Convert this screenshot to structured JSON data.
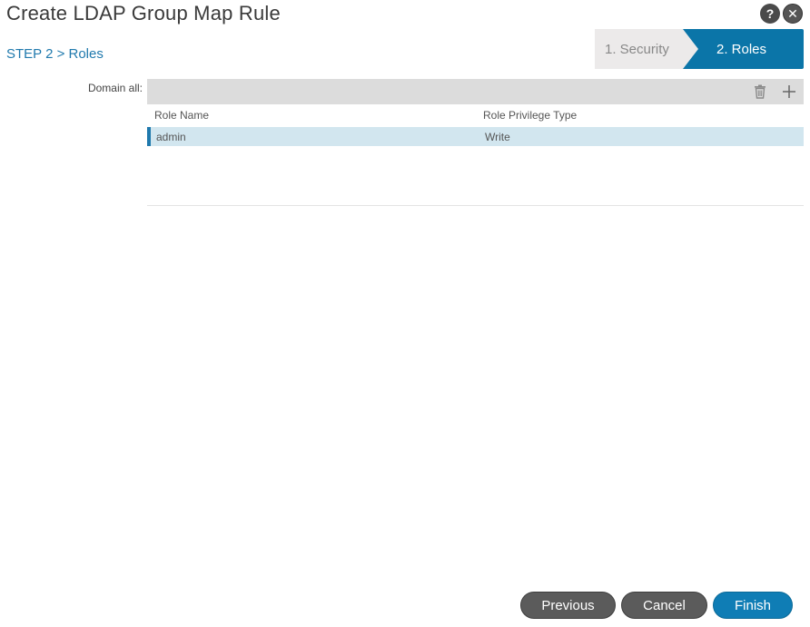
{
  "dialog": {
    "title": "Create LDAP Group Map Rule",
    "help_glyph": "?",
    "close_glyph": "✕"
  },
  "step": {
    "label": "STEP 2 > Roles"
  },
  "wizard": {
    "steps": [
      {
        "label": "1. Security",
        "active": false
      },
      {
        "label": "2. Roles",
        "active": true
      }
    ]
  },
  "domain": {
    "label": "Domain all:",
    "toolbar_icons": [
      "trash-icon",
      "plus-icon"
    ]
  },
  "table": {
    "columns": [
      "Role Name",
      "Role Privilege Type"
    ],
    "rows": [
      {
        "role_name": "admin",
        "privilege": "Write",
        "selected": true
      }
    ]
  },
  "footer": {
    "previous_label": "Previous",
    "cancel_label": "Cancel",
    "finish_label": "Finish"
  },
  "colors": {
    "accent": "#1f79ad",
    "wizard_active": "#0b75a8",
    "selected_row": "#d2e6ef",
    "finish_button": "#0f7db5",
    "secondary_button": "#5b5b5b"
  }
}
